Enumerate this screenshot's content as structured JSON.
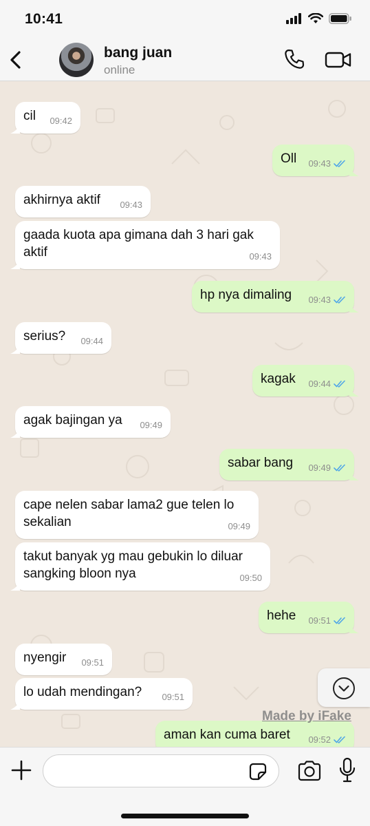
{
  "status_bar": {
    "time": "10:41"
  },
  "contact": {
    "name": "bang juan",
    "status": "online"
  },
  "messages": [
    {
      "dir": "in",
      "text": "cil",
      "time": "09:42"
    },
    {
      "dir": "out",
      "text": "Oll",
      "time": "09:43"
    },
    {
      "dir": "in",
      "text": "akhirnya aktif",
      "time": "09:43"
    },
    {
      "dir": "in",
      "text": "gaada kuota apa gimana dah 3 hari gak aktif",
      "time": "09:43"
    },
    {
      "dir": "out",
      "text": "hp nya dimaling",
      "time": "09:43"
    },
    {
      "dir": "in",
      "text": "serius?",
      "time": "09:44"
    },
    {
      "dir": "out",
      "text": "kagak",
      "time": "09:44"
    },
    {
      "dir": "in",
      "text": "agak bajingan ya",
      "time": "09:49"
    },
    {
      "dir": "out",
      "text": "sabar bang",
      "time": "09:49"
    },
    {
      "dir": "in",
      "text": "cape nelen sabar lama2 gue telen lo sekalian",
      "time": "09:49"
    },
    {
      "dir": "in",
      "text": "takut banyak yg mau gebukin lo diluar sangking bloon nya",
      "time": "09:50"
    },
    {
      "dir": "out",
      "text": "hehe",
      "time": "09:51"
    },
    {
      "dir": "in",
      "text": "nyengir",
      "time": "09:51"
    },
    {
      "dir": "in",
      "text": "lo udah mendingan?",
      "time": "09:51"
    },
    {
      "dir": "out",
      "text": "aman kan cuma baret",
      "time": "09:52"
    }
  ],
  "watermark": "Made by iFake",
  "input": {
    "value": "",
    "placeholder": ""
  },
  "colors": {
    "incoming": "#ffffff",
    "outgoing": "#dcf8c6",
    "read_ticks": "#4fa6e8",
    "background": "#efe7de"
  },
  "icons": [
    "back-icon",
    "phone-icon",
    "video-call-icon",
    "chevron-down-icon",
    "plus-icon",
    "sticker-icon",
    "camera-icon",
    "microphone-icon",
    "double-check-icon"
  ]
}
